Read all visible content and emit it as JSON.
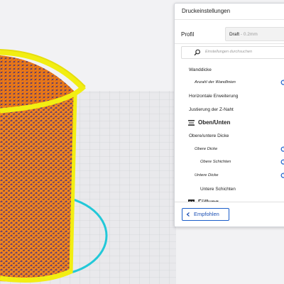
{
  "panel": {
    "title": "Druckeinstellungen",
    "profile_label": "Profil",
    "profile_value": "Draft",
    "profile_sub": " - 0.2mm",
    "search_placeholder": "Einstellungen durchsuchen",
    "settings": [
      {
        "label": "Wanddicke",
        "style": "normal",
        "reset": false
      },
      {
        "label": "Anzahl der Wandlinien",
        "style": "italic",
        "reset": true
      },
      {
        "label": "Horizontale Erweiterung",
        "style": "normal",
        "reset": false
      },
      {
        "label": "Justierung der Z-Naht",
        "style": "normal",
        "reset": false
      }
    ],
    "section_top_bottom": "Oben/Unten",
    "top_bottom_settings": [
      {
        "label": "Obere/untere Dicke",
        "style": "normal",
        "reset": false
      },
      {
        "label": "Obere Dicke",
        "style": "italic",
        "reset": true
      },
      {
        "label": "Obere Schichten",
        "style": "italic",
        "reset": true
      },
      {
        "label": "Untere Dicke",
        "style": "italic",
        "reset": true
      },
      {
        "label": "Untere Schichten",
        "style": "normal",
        "reset": false
      }
    ],
    "section_infill": "Füllung",
    "recommended_button": "Empfohlen"
  },
  "colors": {
    "accent": "#1a5dc9",
    "model_orange": "#f0821e",
    "model_yellow": "#f2ee12",
    "build_plate_outline": "#22c8d8"
  }
}
